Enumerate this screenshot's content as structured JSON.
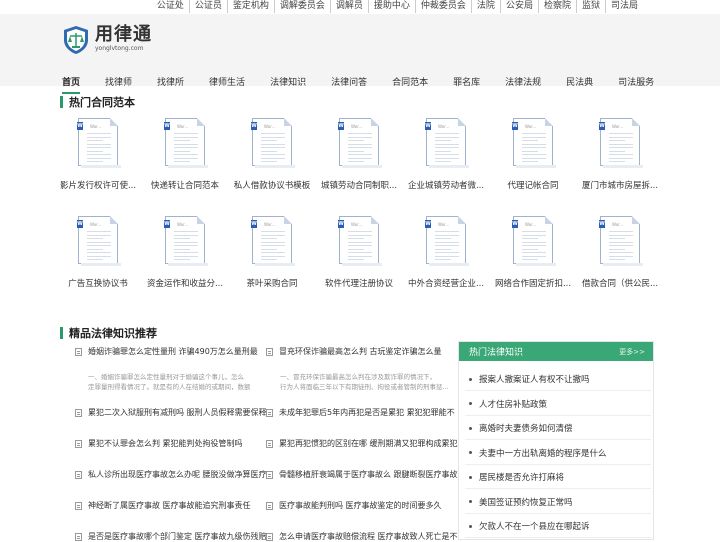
{
  "top_links": [
    "公证处",
    "公证员",
    "鉴定机构",
    "调解委员会",
    "调解员",
    "援助中心",
    "仲裁委员会",
    "法院",
    "公安局",
    "检察院",
    "监狱",
    "司法局"
  ],
  "logo": {
    "cn": "用律通",
    "en": "yonglvtong.com"
  },
  "nav": [
    "首页",
    "找律师",
    "找律所",
    "律师生活",
    "法律知识",
    "法律问答",
    "合同范本",
    "罪名库",
    "法律法规",
    "民法典",
    "司法服务"
  ],
  "contracts_section": {
    "title": "热门合同范本",
    "doc_badge": "W",
    "doc_text": "Wor..."
  },
  "contracts": [
    "影片发行权许可使...",
    "快递转让合同范本",
    "私人借款协议书模板",
    "城镇劳动合同制职...",
    "企业城镇劳动者微...",
    "代理记帐合同",
    "厦门市城市房屋拆...",
    "广告互换协议书",
    "资金运作和收益分...",
    "茶叶采购合同",
    "软件代理注册协议",
    "中外合资经营企业...",
    "网络合作固定折扣...",
    "借款合同（供公民..."
  ],
  "knowledge_section": {
    "title": "精品法律知识推荐"
  },
  "knowledge": {
    "featured": [
      {
        "title": "婚姻诈骗罪怎么定性量刑 诈骗490万怎么量刑最",
        "desc1": "一、婚姻诈骗罪怎么定性量刑对于婚骗这个事儿，怎么",
        "desc2": "定罪量刑得看情况了。就是有的人在结婚的或期间，数额"
      },
      {
        "title": "冒充环保诈骗最高怎么判 古玩鉴定诈骗怎么量",
        "desc1": "一、冒充环保诈骗最高怎么判在涉及欺诈罪的情况下，",
        "desc2": "行为人将面临三年以下有期徒刑、拘役或者管制的刑事惩..."
      }
    ],
    "left": [
      "累犯二次入狱服刑有减刑吗 服刑人员假释需要保释",
      "累犯不认罪会怎么判 累犯能判处拘役管制吗",
      "私人诊所出现医疗事故怎么办呢 腰脱没做净算医疗",
      "神经断了属医疗事故 医疗事故能追究刑事责任",
      "是否是医疗事故哪个部门鉴定 医疗事故九级伤残赔"
    ],
    "right": [
      "未成年犯罪后5年内再犯是否是累犯 累犯犯罪能不",
      "累犯再犯惯犯的区别在哪 缓刑期满又犯罪构成累犯",
      "骨髓移植肝衰竭属于医疗事故么 跟腱断裂医疗事故",
      "医疗事故能判刑吗 医疗事故鉴定的时间要多久",
      "怎么申请医疗事故赔偿流程 医疗事故致人死亡是不"
    ]
  },
  "sidebar": {
    "title": "热门法律知识",
    "more": "更多>>",
    "items": [
      "报案人撤案证人有权不让撤吗",
      "人才住房补贴政策",
      "离婚时夫妻债务如何清偿",
      "夫妻中一方出轨离婚的程序是什么",
      "居民楼是否允许打麻将",
      "美国签证预约恢复正常吗",
      "欠款人不在一个县应在哪起诉"
    ]
  },
  "colors": {
    "accent": "#2a9a6a",
    "sidebar_head": "#3aa776",
    "header_bg": "#f4f4f4",
    "doc_badge": "#2b5db5"
  }
}
